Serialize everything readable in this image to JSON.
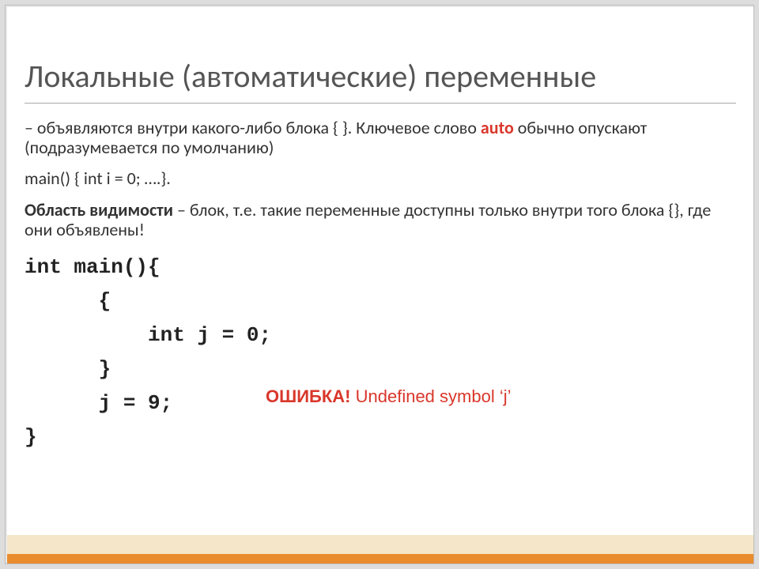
{
  "title": "Локальные (автоматические) переменные",
  "p1_pre": "– объявляются внутри какого-либо блока {  }. Ключевое слово ",
  "p1_kw": "auto",
  "p1_post": " обычно опускают (подразумевается по умолчанию)",
  "p2": "main() { int i = 0; ….}.",
  "p3_bold": "Область видимости",
  "p3_rest": " – блок, т.е. такие переменные доступны только внутри того блока {}, где они объявлены!",
  "code": {
    "l1": "int main(){",
    "l2": "      {",
    "l3": "          int j = 0;",
    "l4": "      }",
    "l5": "      j = 9;",
    "l6": "}"
  },
  "error_bold": "ОШИБКА!",
  "error_rest": " Undefined symbol ‘j’"
}
